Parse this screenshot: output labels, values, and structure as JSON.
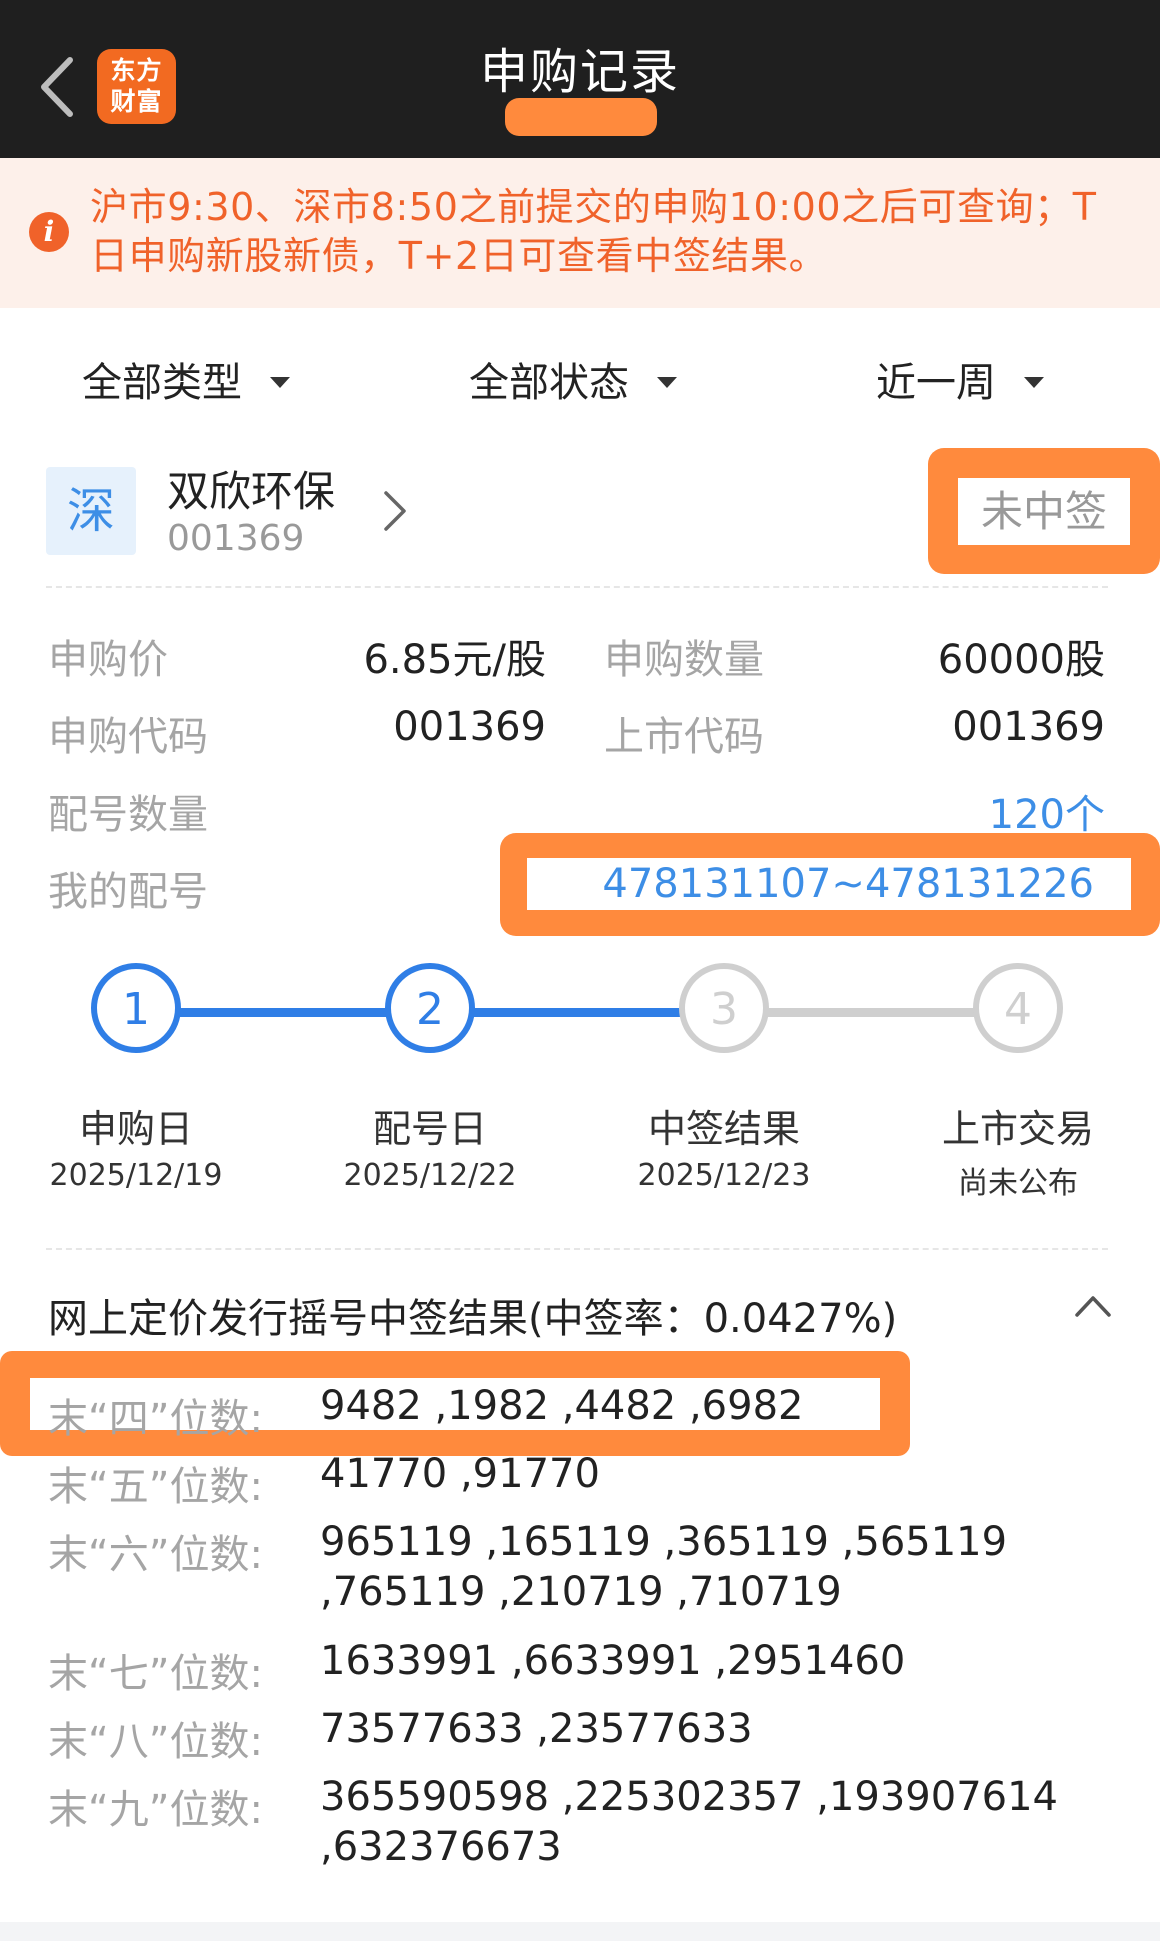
{
  "header": {
    "title": "申购记录",
    "back_icon": "chevron-left-icon",
    "logo_text": "东方财富"
  },
  "notice": {
    "icon": "info-icon",
    "text": "沪市9:30、深市8:50之前提交的申购10:00之后可查询；T日申购新股新债，T+2日可查看中签结果。"
  },
  "filters": {
    "type": "全部类型",
    "status": "全部状态",
    "period": "近一周"
  },
  "stock": {
    "market": "深",
    "name": "双欣环保",
    "code": "001369",
    "status": "未中签"
  },
  "details": {
    "price_label": "申购价",
    "price_value": "6.85元/股",
    "qty_label": "申购数量",
    "qty_value": "60000股",
    "sub_code_label": "申购代码",
    "sub_code_value": "001369",
    "list_code_label": "上市代码",
    "list_code_value": "001369",
    "alloc_count_label": "配号数量",
    "alloc_count_value": "120个",
    "my_alloc_label": "我的配号",
    "my_alloc_value": "478131107~478131226"
  },
  "steps": [
    {
      "num": "1",
      "name": "申购日",
      "date": "2025/12/19",
      "done": true
    },
    {
      "num": "2",
      "name": "配号日",
      "date": "2025/12/22",
      "done": true
    },
    {
      "num": "3",
      "name": "中签结果",
      "date": "2025/12/23",
      "done": false
    },
    {
      "num": "4",
      "name": "上市交易",
      "date": "尚未公布",
      "done": false
    }
  ],
  "result": {
    "title": "网上定价发行摇号中签结果(中签率：0.0427%)",
    "rows": [
      {
        "label": "末“四”位数:",
        "value": "9482 ,1982 ,4482 ,6982"
      },
      {
        "label": "末“五”位数:",
        "value": "41770 ,91770"
      },
      {
        "label": "末“六”位数:",
        "value": "965119 ,165119 ,365119 ,565119 ,765119 ,210719 ,710719"
      },
      {
        "label": "末“七”位数:",
        "value": "1633991 ,6633991 ,2951460"
      },
      {
        "label": "末“八”位数:",
        "value": "73577633 ,23577633"
      },
      {
        "label": "末“九”位数:",
        "value": "365590598 ,225302357 ,193907614 ,632376673"
      }
    ]
  },
  "colors": {
    "accent": "#3d8ee6",
    "highlight": "#ff8a3d",
    "notice_text": "#f0622a"
  }
}
